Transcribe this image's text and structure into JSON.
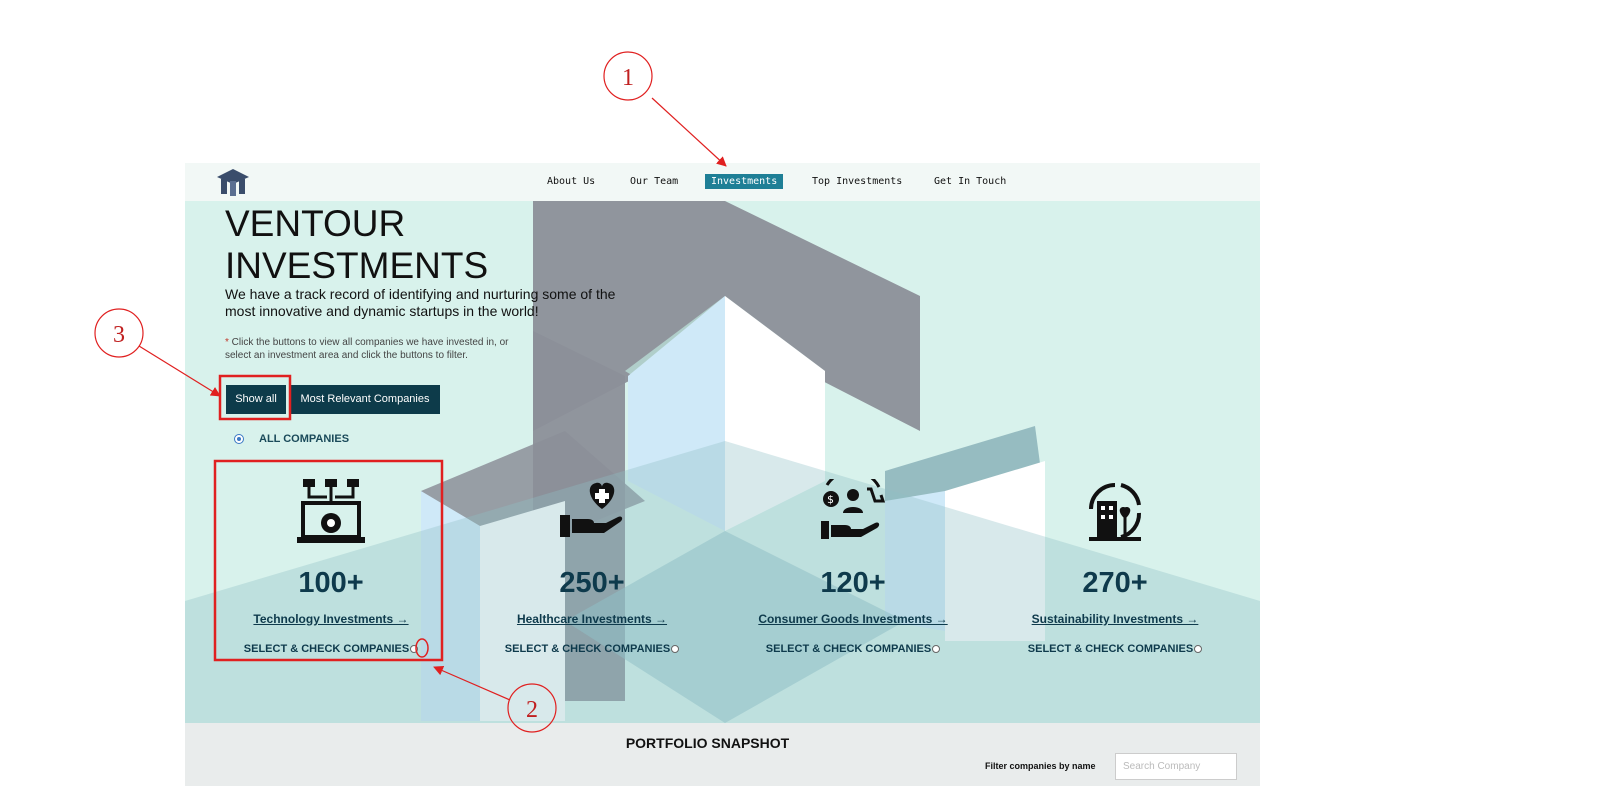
{
  "nav": {
    "items": [
      "About Us",
      "Our Team",
      "Investments",
      "Top Investments",
      "Get In Touch"
    ],
    "active": "Investments"
  },
  "hero": {
    "title_line1": "VENTOUR",
    "title_line2": "INVESTMENTS",
    "subtitle": "We have a track record of identifying and nurturing some of the most innovative and dynamic startups in the world!",
    "note_star": "*",
    "note": " Click the buttons to view all companies we have invested in, or select an investment area and click the buttons to filter."
  },
  "buttons": {
    "show_all": "Show all",
    "most_relevant": "Most Relevant Companies"
  },
  "filter": {
    "all_label": "ALL COMPANIES"
  },
  "cards": [
    {
      "count": "100+",
      "link": "Technology Investments →",
      "select": "SELECT & CHECK COMPANIES",
      "icon": "technology-icon"
    },
    {
      "count": "250+",
      "link": "Healthcare Investments →",
      "select": "SELECT & CHECK COMPANIES",
      "icon": "healthcare-icon"
    },
    {
      "count": "120+",
      "link": "Consumer Goods Investments →",
      "select": "SELECT & CHECK COMPANIES",
      "icon": "consumer-goods-icon"
    },
    {
      "count": "270+",
      "link": "Sustainability Investments →",
      "select": "SELECT & CHECK COMPANIES",
      "icon": "sustainability-icon"
    }
  ],
  "snapshot": {
    "title": "PORTFOLIO SNAPSHOT",
    "filter_label": "Filter companies by name",
    "search_placeholder": "Search Company"
  },
  "annotations": {
    "marker1": "1",
    "marker2": "2",
    "marker3": "3",
    "color": "#e02020"
  }
}
